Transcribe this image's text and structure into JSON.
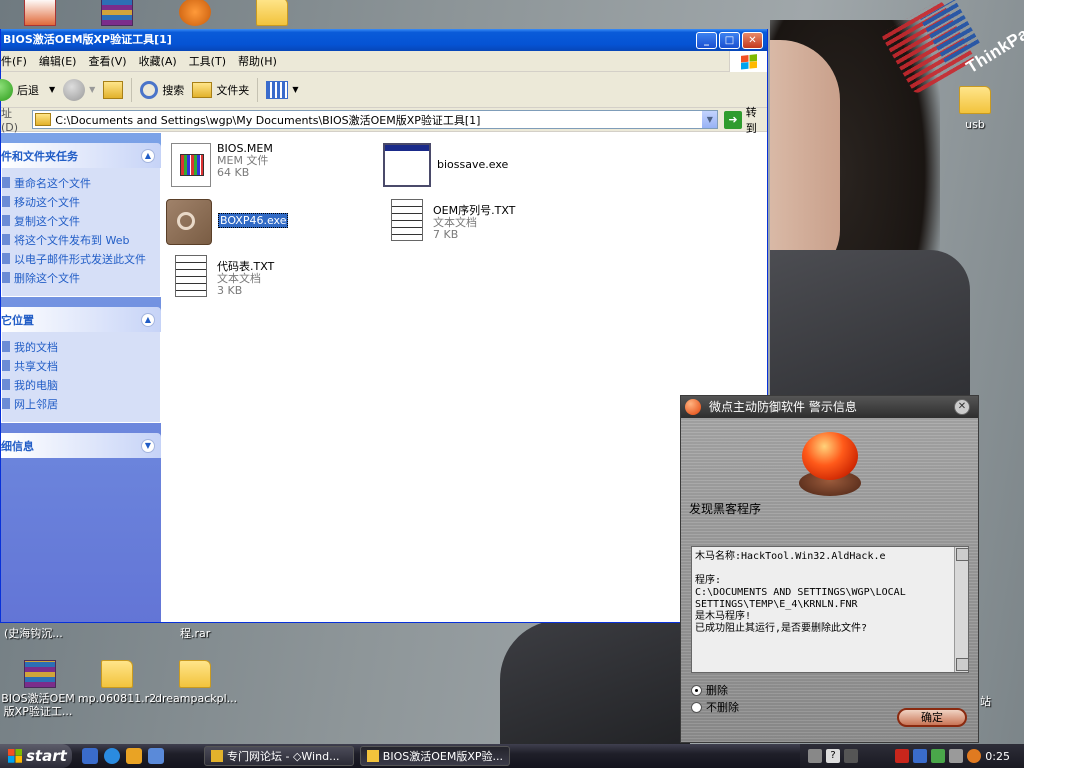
{
  "desktop": {
    "brand": "ThinkPad",
    "icons": {
      "usb": "usb",
      "bios_rar": "BIOS激活OEM版XP验证工...",
      "mp": "mp.060811.r2",
      "dreampack": "dreampackpl...",
      "left_cut": "(史海钩沉...",
      "rar_cut": "程.rar",
      "recycle_cut": "站"
    }
  },
  "explorer": {
    "title": "BIOS激活OEM版XP验证工具[1]",
    "menu": [
      "件(F)",
      "编辑(E)",
      "查看(V)",
      "收藏(A)",
      "工具(T)",
      "帮助(H)"
    ],
    "toolbar": {
      "back": "后退",
      "search": "搜索",
      "folders": "文件夹"
    },
    "address": {
      "label": "址(D)",
      "value": "C:\\Documents and Settings\\wgp\\My Documents\\BIOS激活OEM版XP验证工具[1]",
      "go": "转到"
    },
    "taskpane": {
      "file_tasks_title": "件和文件夹任务",
      "file_tasks": [
        "重命名这个文件",
        "移动这个文件",
        "复制这个文件",
        "将这个文件发布到 Web",
        "以电子邮件形式发送此文件",
        "删除这个文件"
      ],
      "places_title": "它位置",
      "places": [
        "我的文档",
        "共享文档",
        "我的电脑",
        "网上邻居"
      ],
      "details_title": "细信息"
    },
    "files": [
      {
        "name": "BIOS.MEM",
        "type": "MEM 文件",
        "size": "64 KB"
      },
      {
        "name": "biossave.exe",
        "type": "",
        "size": ""
      },
      {
        "name": "BOXP46.exe",
        "type": "",
        "size": ""
      },
      {
        "name": "OEM序列号.TXT",
        "type": "文本文档",
        "size": "7 KB"
      },
      {
        "name": "代码表.TXT",
        "type": "文本文档",
        "size": "3 KB"
      }
    ]
  },
  "alert": {
    "title": "微点主动防御软件   警示信息",
    "heading": "发现黑客程序",
    "lines": [
      "木马名称:HackTool.Win32.AldHack.e",
      "",
      "程序:",
      "C:\\DOCUMENTS AND SETTINGS\\WGP\\LOCAL",
      "SETTINGS\\TEMP\\E_4\\KRNLN.FNR",
      "是木马程序!",
      "已成功阻止其运行,是否要删除此文件?"
    ],
    "option_delete": "删除",
    "option_keep": "不删除",
    "ok": "确定",
    "selected_option": "删除"
  },
  "taskbar": {
    "start": "start",
    "tasks": [
      "专门网论坛 - ◇Wind...",
      "BIOS激活OEM版XP验..."
    ],
    "clock": "0:25"
  }
}
